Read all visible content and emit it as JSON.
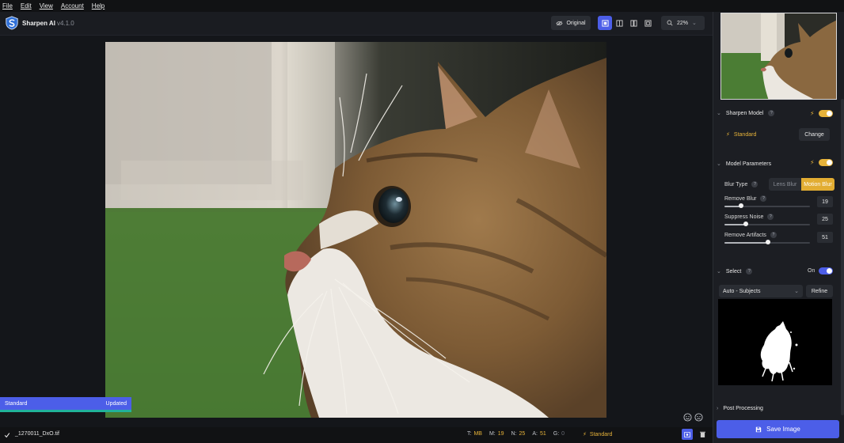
{
  "menu": [
    "File",
    "Edit",
    "View",
    "Account",
    "Help"
  ],
  "app": {
    "name": "Sharpen AI",
    "version": "v4.1.0"
  },
  "toolbar": {
    "original_label": "Original",
    "zoom": "22%"
  },
  "status": {
    "model": "Standard",
    "state": "Updated"
  },
  "bottom": {
    "filename": "_1270011_DxO.tif",
    "stats": [
      {
        "key": "T:",
        "value": "MB"
      },
      {
        "key": "M:",
        "value": "19"
      },
      {
        "key": "N:",
        "value": "25"
      },
      {
        "key": "A:",
        "value": "51"
      },
      {
        "key": "G:",
        "value": "0"
      }
    ],
    "model": "Standard"
  },
  "sidebar": {
    "sharpen_model": {
      "title": "Sharpen Model",
      "help": "?",
      "model": "Standard",
      "change_label": "Change",
      "enabled": true
    },
    "model_params": {
      "title": "Model Parameters",
      "help": "?",
      "enabled": true,
      "blur_type_label": "Blur Type",
      "blur_options": [
        "Lens Blur",
        "Motion Blur"
      ],
      "blur_selected": "Motion Blur",
      "sliders": [
        {
          "label": "Remove Blur",
          "value": "19",
          "level": 19
        },
        {
          "label": "Suppress Noise",
          "value": "25",
          "level": 25
        },
        {
          "label": "Remove Artifacts",
          "value": "51",
          "level": 51
        }
      ]
    },
    "select": {
      "title": "Select",
      "help": "?",
      "state_label": "On",
      "mode": "Auto - Subjects",
      "refine_label": "Refine"
    },
    "post_processing": {
      "title": "Post Processing"
    },
    "save_label": "Save Image"
  },
  "colors": {
    "accent": "#4c5ee8",
    "gold": "#e7b33a",
    "teal": "#21b39a"
  }
}
